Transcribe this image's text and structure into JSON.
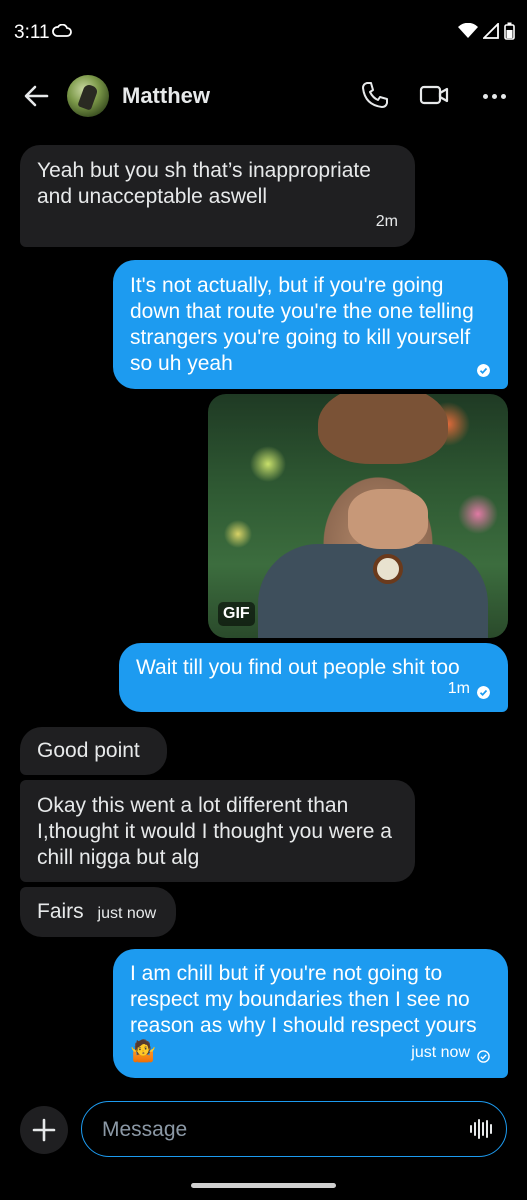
{
  "status_bar": {
    "time": "3:11"
  },
  "header": {
    "contact_name": "Matthew"
  },
  "messages": [
    {
      "text": "Yeah but you sh that’s inappropriate and unacceptable aswell",
      "time": "2m"
    },
    {
      "text": "It's not actually, but if you're going down that route you're the one telling strangers you're going to kill yourself so uh yeah"
    },
    {
      "gif_label": "GIF"
    },
    {
      "text": "Wait till you find out people shit too",
      "time": "1m"
    },
    {
      "text": "Good point"
    },
    {
      "text": "Okay this went a lot different than I,thought it would I thought you were a chill nigga but alg"
    },
    {
      "text": "Fairs",
      "time": "just now"
    },
    {
      "text": "I am chill but if you're not going to respect my boundaries then I see no reason as why I should respect yours 🤷",
      "time": "just now"
    }
  ],
  "composer": {
    "placeholder": "Message"
  },
  "colors": {
    "accent": "#1d9bf0",
    "incoming_bubble": "#1f1f21",
    "background": "#000000"
  }
}
